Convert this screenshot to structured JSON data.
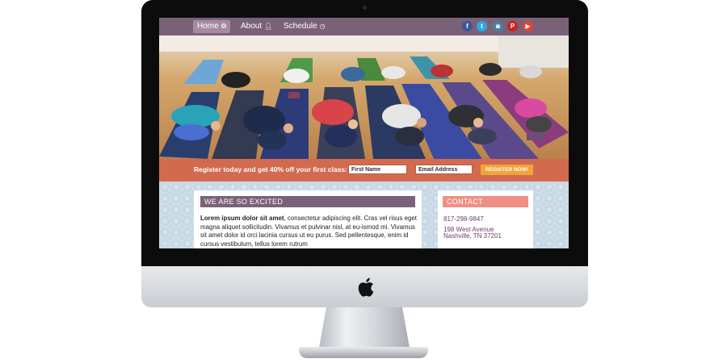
{
  "nav": {
    "items": [
      {
        "label": "Home",
        "icon": "home-icon",
        "active": true
      },
      {
        "label": "About",
        "icon": "user-icon",
        "active": false
      },
      {
        "label": "Schedule",
        "icon": "clock-icon",
        "active": false
      }
    ],
    "social": [
      {
        "icon": "facebook-icon",
        "glyph": "f"
      },
      {
        "icon": "twitter-icon",
        "glyph": "t"
      },
      {
        "icon": "instagram-icon",
        "glyph": "◙"
      },
      {
        "icon": "pinterest-icon",
        "glyph": "P"
      },
      {
        "icon": "youtube-icon",
        "glyph": "▶"
      }
    ]
  },
  "register": {
    "text": "Register today and get 40% off your first class:",
    "first_name_placeholder": "First Name",
    "email_placeholder": "Email Address",
    "button_label": "REGISTER NOW!"
  },
  "main": {
    "title": "WE ARE SO EXCITED",
    "lead_bold": "Lorem ipsum dolor sit amet",
    "body": ", consectetur adipiscing elit. Cras vel risus eget magna aliquet sollicitudin. Vivamus et pulvinar nisl, at eu-ismod mi. Vivamus sit amet dolor id orci lacinia cursus ut eu purus. Sed pellentesque, enim id cursus vestibulum, tellus lorem rutrum"
  },
  "contact": {
    "title": "CONTACT",
    "phone": "817-298-9847",
    "address_line1": "198 West Avenue",
    "address_line2": "Nashville, TN 37201"
  },
  "colors": {
    "nav": "#7a6178",
    "register_bar": "#d36a4e",
    "button": "#f0a53a",
    "contact_header": "#f08f84"
  }
}
